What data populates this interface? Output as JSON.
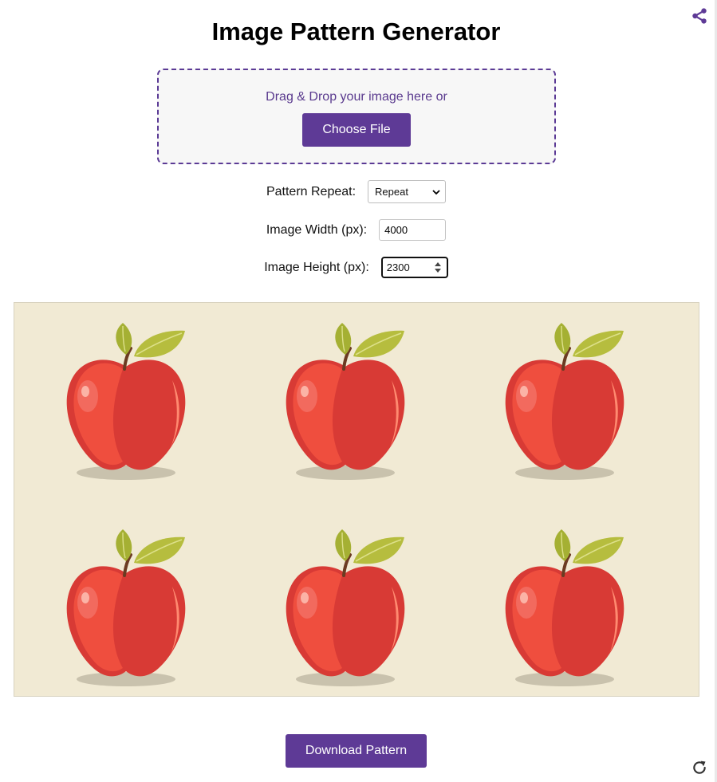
{
  "page": {
    "title": "Image Pattern Generator"
  },
  "upload": {
    "drop_text": "Drag & Drop your image here or",
    "choose_label": "Choose File"
  },
  "controls": {
    "repeat_label": "Pattern Repeat:",
    "repeat_value": "Repeat",
    "width_label": "Image Width (px):",
    "width_value": "4000",
    "height_label": "Image Height (px):",
    "height_value": "2300"
  },
  "preview": {
    "background_color": "#f1ead4",
    "tile_icon": "apple-icon",
    "rows": 2,
    "columns": 3
  },
  "actions": {
    "download_label": "Download Pattern"
  },
  "icons": {
    "share": "share-icon",
    "refresh": "refresh-icon"
  },
  "colors": {
    "accent": "#5e3a96",
    "drop_border": "#5b3a95"
  }
}
